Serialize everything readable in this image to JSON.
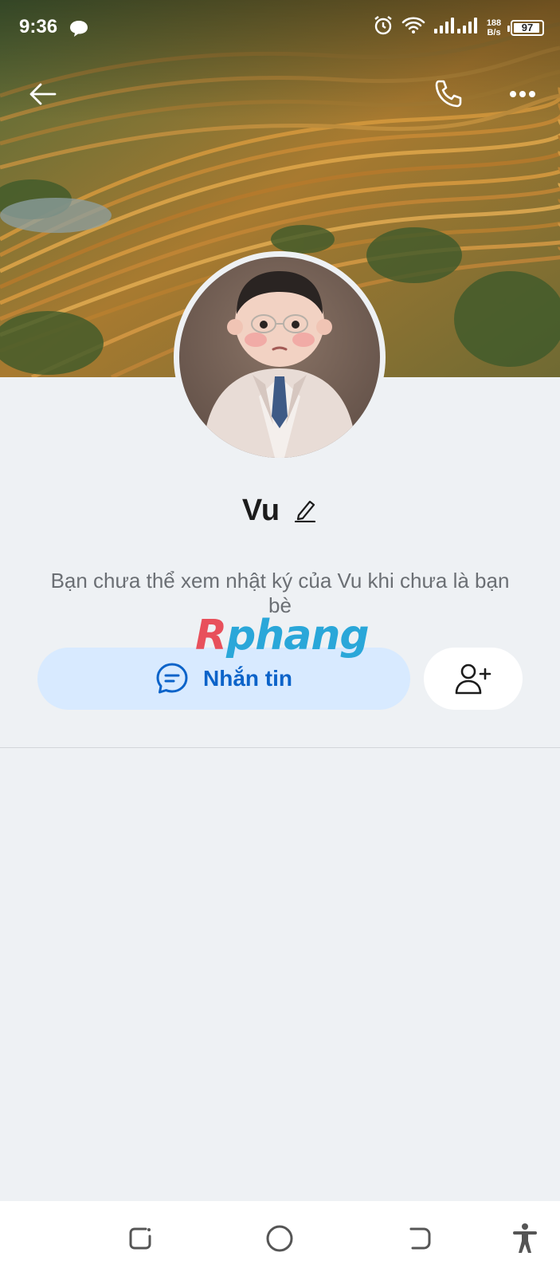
{
  "status_bar": {
    "time": "9:36",
    "net_speed_value": "188",
    "net_speed_unit": "B/s",
    "battery": "97"
  },
  "profile": {
    "name": "Vu",
    "privacy_note": "Bạn chưa thể xem nhật ký của Vu khi chưa là bạn bè"
  },
  "actions": {
    "message_label": "Nhắn tin"
  },
  "watermark": {
    "first": "R",
    "rest": "phang"
  },
  "colors": {
    "accent": "#0b63c9",
    "message_button_bg": "#d8eaff",
    "page_bg": "#eef1f4"
  },
  "icons": {
    "back": "arrow-left-icon",
    "call": "phone-icon",
    "more": "more-horizontal-icon",
    "edit": "pencil-icon",
    "message": "chat-bubble-icon",
    "add_friend": "add-user-icon"
  }
}
